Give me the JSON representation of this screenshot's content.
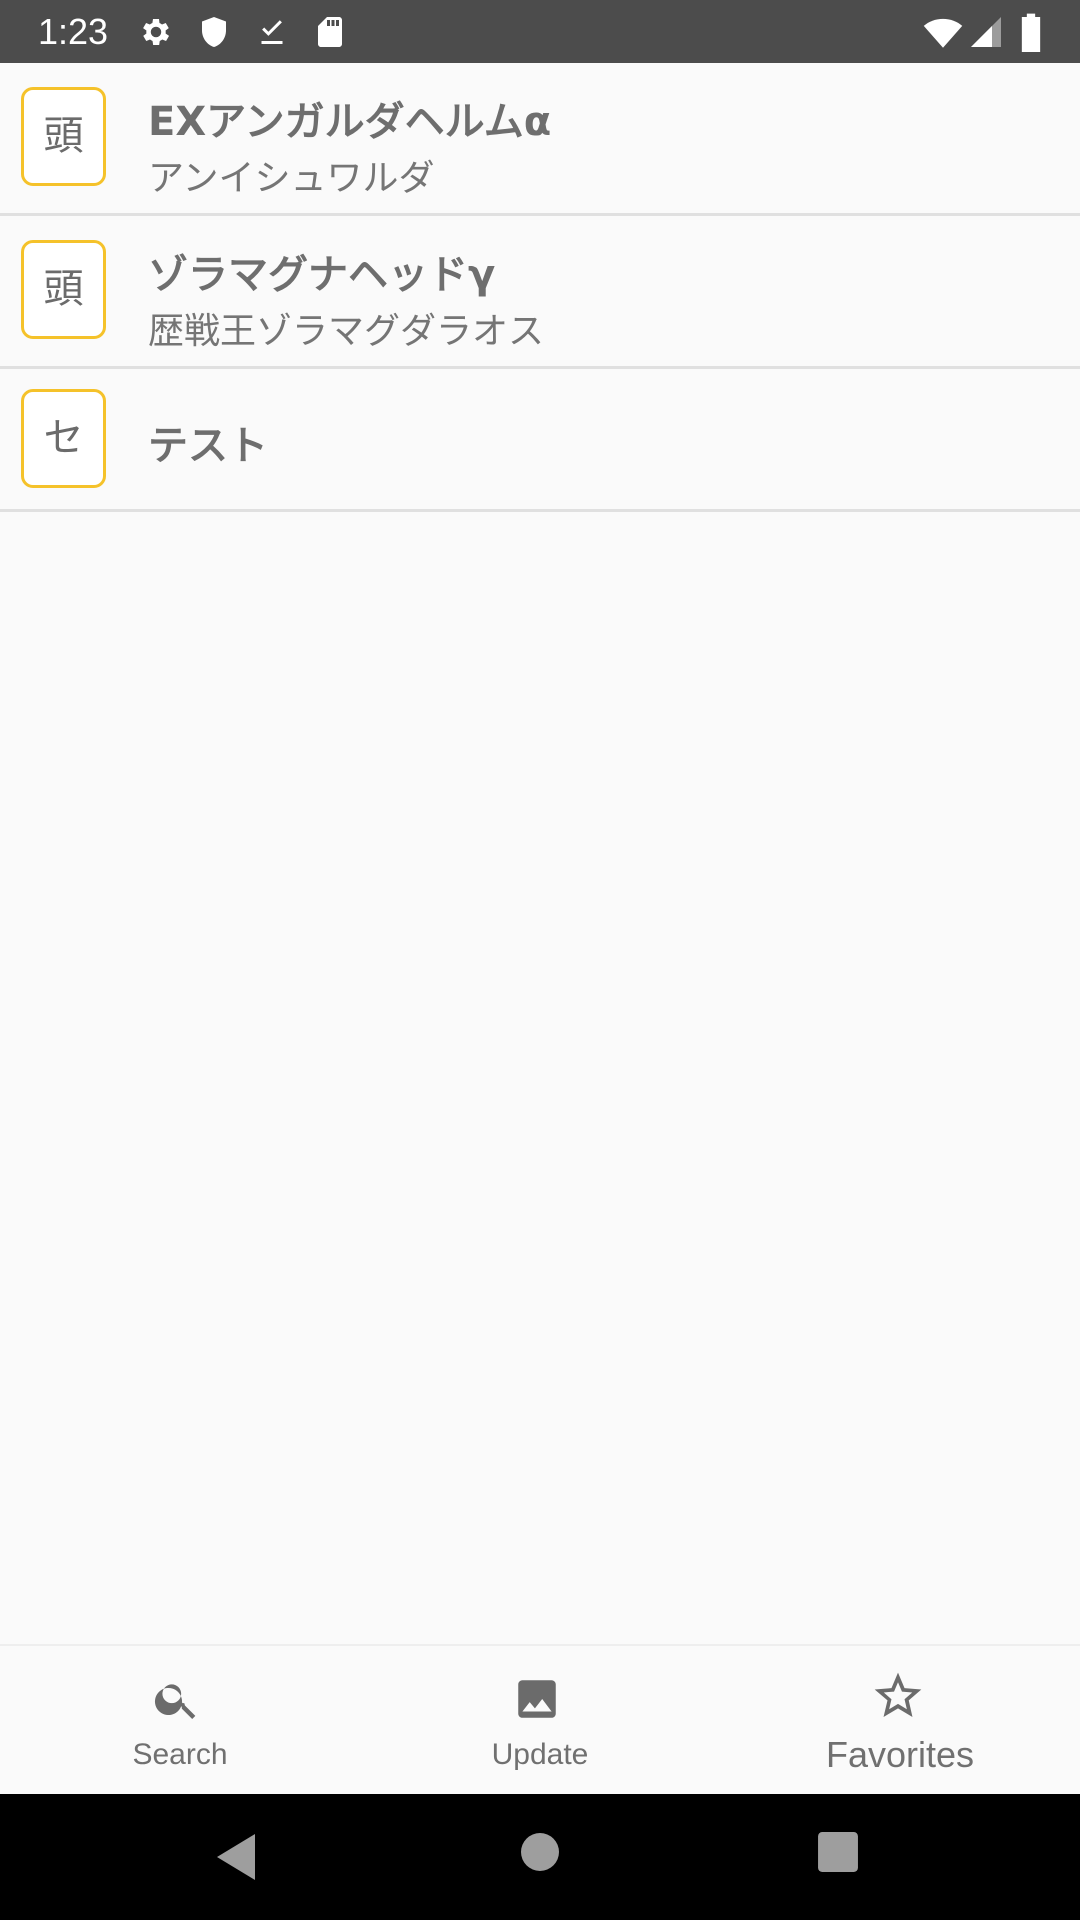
{
  "status_bar": {
    "time": "1:23",
    "icons": [
      "gear-icon",
      "shield-icon",
      "download-done-icon",
      "sd-card-icon",
      "wifi-icon",
      "signal-icon",
      "battery-icon"
    ]
  },
  "list": {
    "items": [
      {
        "badge": "頭",
        "title": "EXアンガルダヘルムα",
        "subtitle": "アンイシュワルダ"
      },
      {
        "badge": "頭",
        "title": "ゾラマグナヘッドγ",
        "subtitle": "歴戦王ゾラマグダラオス"
      },
      {
        "badge": "セ",
        "title": "テスト"
      }
    ]
  },
  "bottom_nav": {
    "items": [
      {
        "label": "Search",
        "icon": "search-icon"
      },
      {
        "label": "Update",
        "icon": "image-icon"
      },
      {
        "label": "Favorites",
        "icon": "star-outline-icon"
      }
    ],
    "selected": "Favorites"
  },
  "colors": {
    "badge_border": "#f5c22a",
    "status_bar": "#4c4c4c",
    "background": "#fafafa",
    "nav_bar": "#000000"
  }
}
